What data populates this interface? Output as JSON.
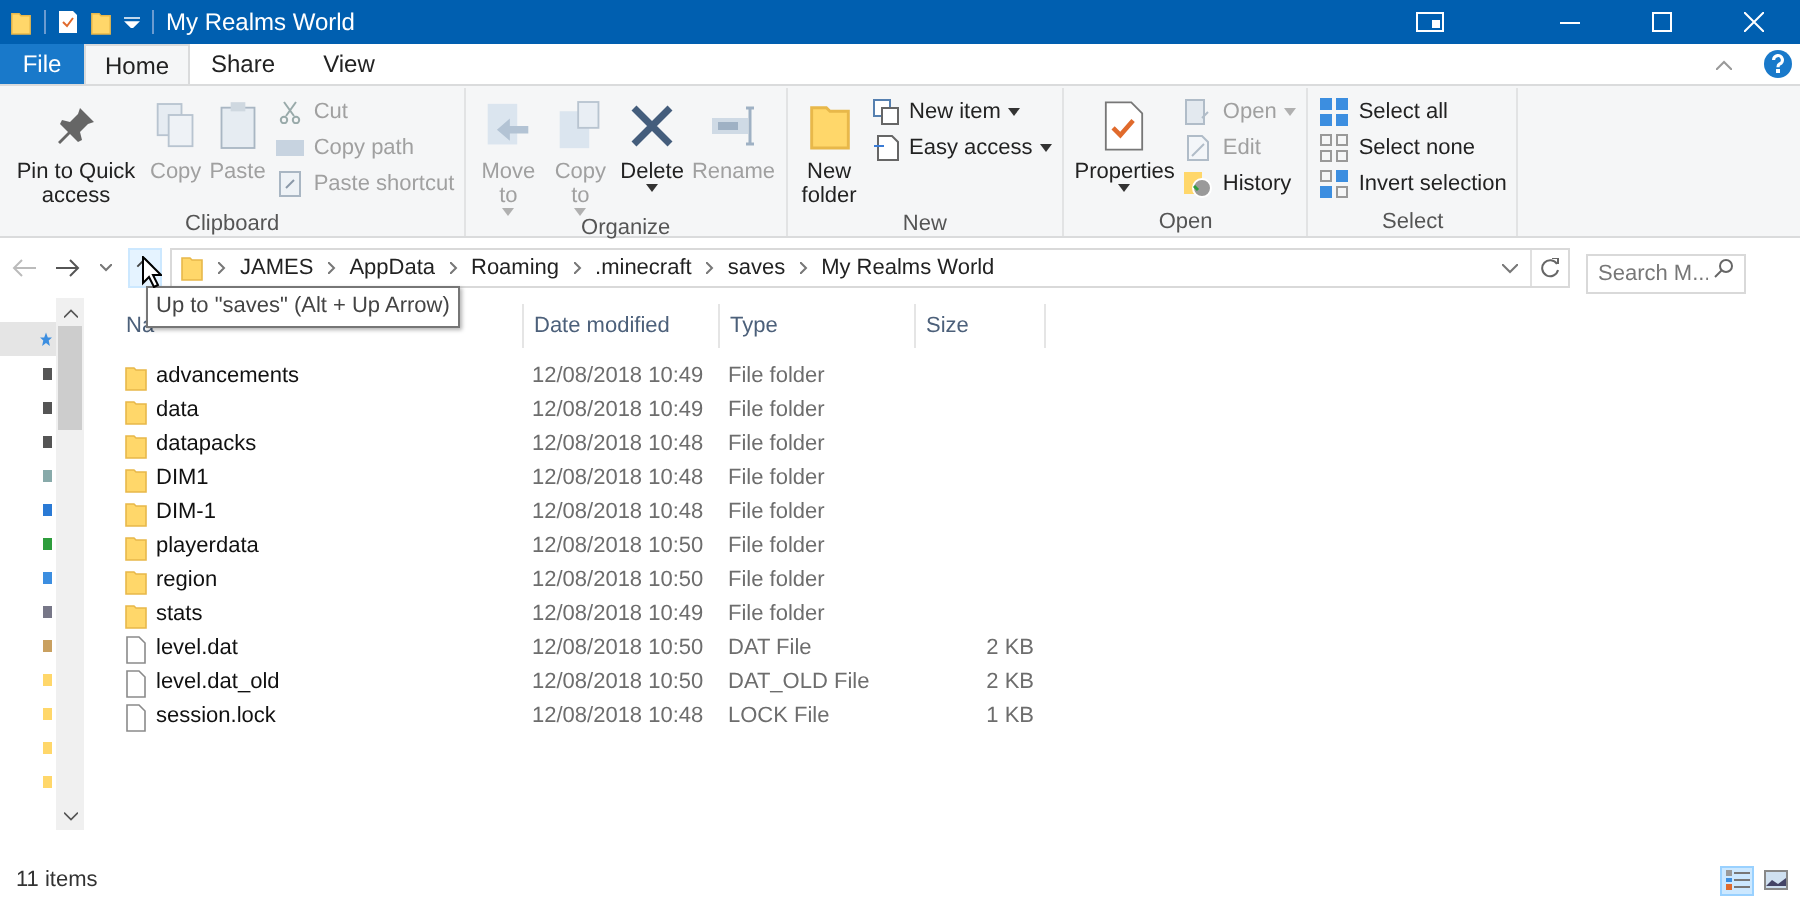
{
  "title_bar": {
    "title": "My Realms World"
  },
  "ribbon_tabs": [
    {
      "label": "File",
      "kind": "file",
      "selected": false
    },
    {
      "label": "Home",
      "kind": "tab",
      "selected": true
    },
    {
      "label": "Share",
      "kind": "tab",
      "selected": false
    },
    {
      "label": "View",
      "kind": "tab",
      "selected": false
    }
  ],
  "ribbon_groups": [
    {
      "label": "Clipboard",
      "buttons": [
        {
          "label": "Pin to Quick access",
          "kind": "large",
          "disabled": false,
          "dropdown": false
        },
        {
          "label": "Copy",
          "kind": "large",
          "disabled": true,
          "dropdown": false
        },
        {
          "label": "Paste",
          "kind": "large",
          "disabled": true,
          "dropdown": false
        },
        {
          "label": "Cut",
          "kind": "small",
          "disabled": true,
          "dropdown": false
        },
        {
          "label": "Copy path",
          "kind": "small",
          "disabled": true,
          "dropdown": false
        },
        {
          "label": "Paste shortcut",
          "kind": "small",
          "disabled": true,
          "dropdown": false
        }
      ]
    },
    {
      "label": "Organize",
      "buttons": [
        {
          "label": "Move to",
          "kind": "large",
          "disabled": true,
          "dropdown": true
        },
        {
          "label": "Copy to",
          "kind": "large",
          "disabled": true,
          "dropdown": true
        },
        {
          "label": "Delete",
          "kind": "large",
          "disabled": false,
          "dropdown": true
        },
        {
          "label": "Rename",
          "kind": "large",
          "disabled": true,
          "dropdown": false
        }
      ]
    },
    {
      "label": "New",
      "buttons": [
        {
          "label": "New folder",
          "kind": "large",
          "disabled": false,
          "dropdown": false
        },
        {
          "label": "New item",
          "kind": "small",
          "disabled": false,
          "dropdown": true
        },
        {
          "label": "Easy access",
          "kind": "small",
          "disabled": false,
          "dropdown": true
        }
      ]
    },
    {
      "label": "Open",
      "buttons": [
        {
          "label": "Properties",
          "kind": "large",
          "disabled": false,
          "dropdown": true
        },
        {
          "label": "Open",
          "kind": "small",
          "disabled": true,
          "dropdown": true
        },
        {
          "label": "Edit",
          "kind": "small",
          "disabled": true,
          "dropdown": false
        },
        {
          "label": "History",
          "kind": "small",
          "disabled": false,
          "dropdown": false
        }
      ]
    },
    {
      "label": "Select",
      "buttons": [
        {
          "label": "Select all",
          "kind": "small",
          "disabled": false,
          "dropdown": false
        },
        {
          "label": "Select none",
          "kind": "small",
          "disabled": false,
          "dropdown": false
        },
        {
          "label": "Invert selection",
          "kind": "small",
          "disabled": false,
          "dropdown": false
        }
      ]
    }
  ],
  "breadcrumbs": [
    "JAMES",
    "AppData",
    "Roaming",
    ".minecraft",
    "saves",
    "My Realms World"
  ],
  "search": {
    "placeholder": "Search M..."
  },
  "tooltip": {
    "text": "Up to \"saves\" (Alt + Up Arrow)"
  },
  "columns": [
    "Na",
    "Date modified",
    "Type",
    "Size"
  ],
  "rows": [
    {
      "kind": "folder",
      "name": "advancements",
      "date": "12/08/2018 10:49",
      "type": "File folder"
    },
    {
      "kind": "folder",
      "name": "data",
      "date": "12/08/2018 10:49",
      "type": "File folder"
    },
    {
      "kind": "folder",
      "name": "datapacks",
      "date": "12/08/2018 10:48",
      "type": "File folder"
    },
    {
      "kind": "folder",
      "name": "DIM1",
      "date": "12/08/2018 10:48",
      "type": "File folder"
    },
    {
      "kind": "folder",
      "name": "DIM-1",
      "date": "12/08/2018 10:48",
      "type": "File folder"
    },
    {
      "kind": "folder",
      "name": "playerdata",
      "date": "12/08/2018 10:50",
      "type": "File folder"
    },
    {
      "kind": "folder",
      "name": "region",
      "date": "12/08/2018 10:50",
      "type": "File folder"
    },
    {
      "kind": "folder",
      "name": "stats",
      "date": "12/08/2018 10:49",
      "type": "File folder"
    },
    {
      "kind": "file",
      "name": "level.dat",
      "date": "12/08/2018 10:50",
      "type": "DAT File",
      "size": "2 KB"
    },
    {
      "kind": "file",
      "name": "level.dat_old",
      "date": "12/08/2018 10:50",
      "type": "DAT_OLD File",
      "size": "2 KB"
    },
    {
      "kind": "file",
      "name": "session.lock",
      "date": "12/08/2018 10:48",
      "type": "LOCK File",
      "size": "1 KB"
    }
  ],
  "status_bar": {
    "count": "11 items"
  },
  "view_buttons": [
    {
      "selected": true
    },
    {
      "selected": false
    }
  ]
}
